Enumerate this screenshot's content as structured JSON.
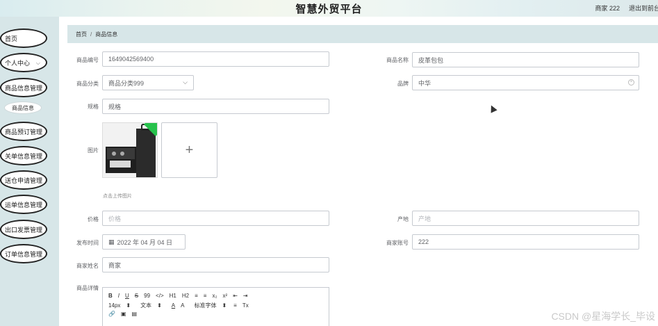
{
  "header": {
    "title": "智慧外贸平台",
    "user_label": "商家 222",
    "logout_label": "退出到前台"
  },
  "sidebar": {
    "items": [
      {
        "label": "首页"
      },
      {
        "label": "个人中心",
        "has_chevron": true
      },
      {
        "label": "商品信息管理"
      },
      {
        "label": "商品预订管理"
      },
      {
        "label": "关单信息管理"
      },
      {
        "label": "送仓申请管理"
      },
      {
        "label": "运单信息管理"
      },
      {
        "label": "出口发票管理"
      },
      {
        "label": "订单信息管理"
      }
    ],
    "submenu": {
      "label": "商品信息"
    }
  },
  "breadcrumb": {
    "home": "首页",
    "separator": "/",
    "current": "商品信息"
  },
  "form": {
    "product_no": {
      "label": "商品编号",
      "value": "1649042569400"
    },
    "product_name": {
      "label": "商品名称",
      "value": "皮革包包"
    },
    "category": {
      "label": "商品分类",
      "value": "商品分类999"
    },
    "brand": {
      "label": "品牌",
      "value": "中华"
    },
    "spec": {
      "label": "规格",
      "value": "规格"
    },
    "image": {
      "label": "图片",
      "hint": "点击上传图片",
      "upload_icon": "+"
    },
    "price": {
      "label": "价格",
      "placeholder": "价格"
    },
    "origin": {
      "label": "产地",
      "placeholder": "产地"
    },
    "publish_time": {
      "label": "发布时间",
      "value": "2022 年 04 月 04 日"
    },
    "merchant_account": {
      "label": "商家账号",
      "value": "222"
    },
    "merchant_name": {
      "label": "商家姓名",
      "value": "商家"
    },
    "details": {
      "label": "商品详情"
    }
  },
  "editor_toolbar": {
    "row1": [
      "B",
      "I",
      "U",
      "S",
      "99",
      "</>",
      "H1",
      "H2",
      "≡",
      "≡",
      "x₂",
      "x²",
      "⇤",
      "⇥"
    ],
    "row2": [
      "14px",
      "⬍",
      "文本",
      "⬍",
      "A",
      "A",
      "标准字体",
      "⬍",
      "≡",
      "Tx"
    ],
    "row3": [
      "🔗",
      "▣",
      "▤"
    ]
  },
  "watermark": "CSDN @星海学长_毕设",
  "colors": {
    "sidebar_bg": "#d7e6e8",
    "breadcrumb_bg": "#d7e6e8",
    "upload_badge": "#27c24c"
  }
}
